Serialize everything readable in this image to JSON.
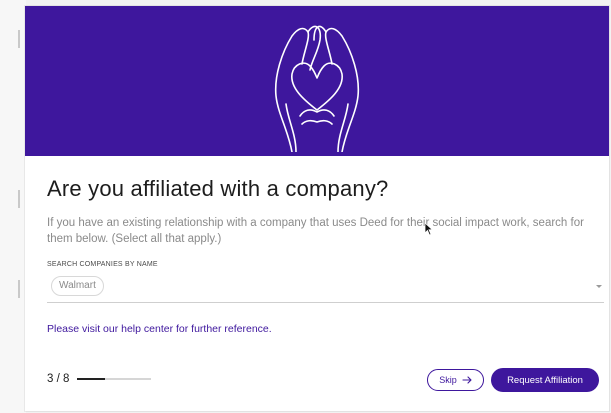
{
  "colors": {
    "brand": "#3e179d",
    "hero_line": "#ffffff",
    "text_primary": "#1d1d1d",
    "text_muted": "#8a8a8a"
  },
  "hero": {
    "illustration": "hands-heart-icon"
  },
  "title": "Are you affiliated with a company?",
  "subtitle": "If you have an existing relationship with a company that uses Deed for their social impact work, search for them below. (Select all that apply.)",
  "search": {
    "label": "SEARCH COMPANIES BY NAME",
    "selected": [
      "Walmart"
    ],
    "dropdown_icon": "caret-down-icon"
  },
  "help_link": "Please visit our help center for further reference.",
  "progress": {
    "text": "3 / 8",
    "fraction": 0.375
  },
  "buttons": {
    "skip_label": "Skip",
    "skip_icon": "arrow-right-icon",
    "request_label": "Request Affiliation"
  }
}
